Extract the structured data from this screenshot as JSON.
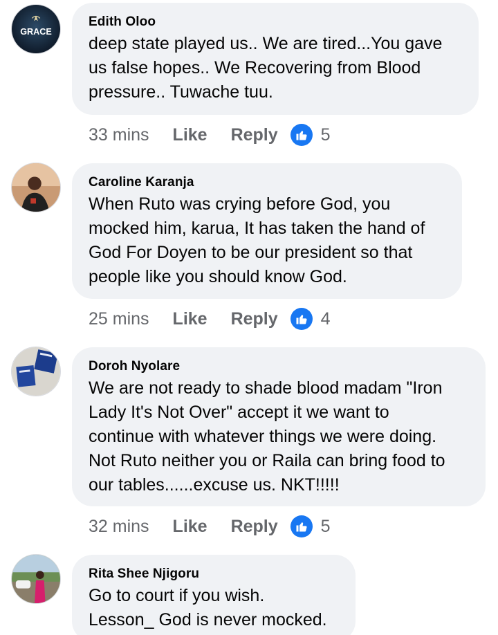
{
  "comments": [
    {
      "author": "Edith Oloo",
      "avatar_text": "GRACE",
      "lines": [
        "deep state played us.. We are tired...You gave",
        "us false hopes.. We  Recovering from Blood",
        "pressure.. Tuwache tuu."
      ],
      "time": "33 mins",
      "like_label": "Like",
      "reply_label": "Reply",
      "reaction_icon": "thumbs-up-icon",
      "reaction_count": "5"
    },
    {
      "author": "Caroline Karanja",
      "lines": [
        "When Ruto was crying before God, you",
        "mocked him, karua, It has taken the hand of",
        "God For Doyen to be our president so that",
        "people like you should know God."
      ],
      "time": "25 mins",
      "like_label": "Like",
      "reply_label": "Reply",
      "reaction_icon": "thumbs-up-icon",
      "reaction_count": "4"
    },
    {
      "author": "Doroh Nyolare",
      "lines": [
        "We are not ready to shade blood madam \"Iron",
        "Lady It's Not Over\" accept it we want to",
        "continue with whatever things we were doing.",
        "Not Ruto neither you or Raila can bring food to",
        "our tables......excuse us. NKT!!!!!"
      ],
      "time": "32 mins",
      "like_label": "Like",
      "reply_label": "Reply",
      "reaction_icon": "thumbs-up-icon",
      "reaction_count": "5"
    },
    {
      "author": "Rita Shee Njigoru",
      "lines": [
        "Go to court if you wish.",
        "Lesson_ God is never mocked."
      ]
    }
  ],
  "colors": {
    "bubble_bg": "#f0f2f5",
    "meta_text": "#65676b",
    "like_blue": "#1877f2"
  }
}
